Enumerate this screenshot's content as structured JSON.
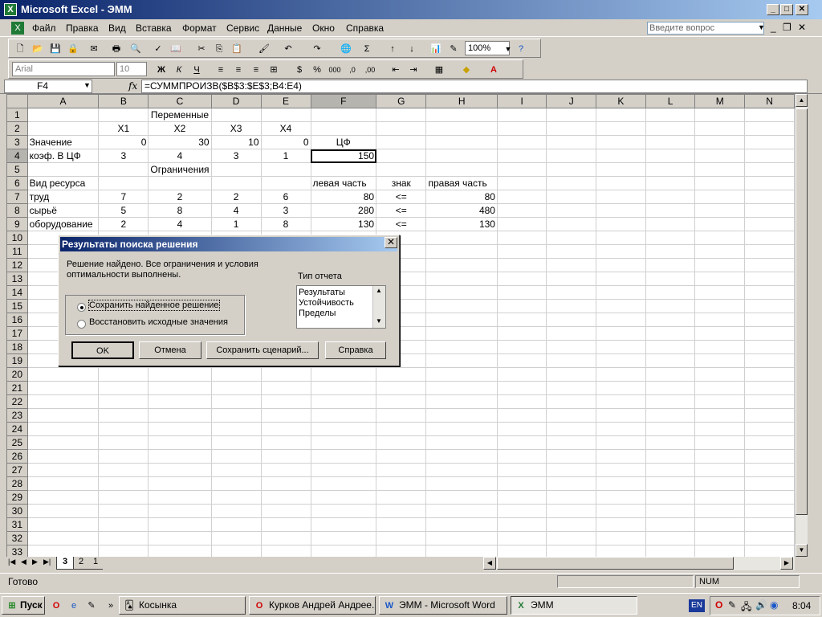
{
  "window": {
    "title": "Microsoft Excel - ЭММ",
    "controls": [
      "_",
      "□",
      "✕"
    ]
  },
  "menu": {
    "items": [
      "Файл",
      "Правка",
      "Вид",
      "Вставка",
      "Формат",
      "Сервис",
      "Данные",
      "Окно",
      "Справка"
    ],
    "help_placeholder": "Введите вопрос"
  },
  "toolbar": {
    "zoom": "100%",
    "font": "Arial",
    "size": "10"
  },
  "formula_bar": {
    "name_box": "F4",
    "fx": "fx",
    "formula": "=СУММПРОИЗВ($B$3:$E$3;B4:E4)"
  },
  "columns": [
    "A",
    "B",
    "C",
    "D",
    "E",
    "F",
    "G",
    "H",
    "I",
    "J",
    "K",
    "L",
    "M",
    "N"
  ],
  "cells": {
    "r1": {
      "C": "Переменные"
    },
    "r2": {
      "B": "X1",
      "C": "X2",
      "D": "X3",
      "E": "X4"
    },
    "r3": {
      "A": "Значение",
      "B": "0",
      "C": "30",
      "D": "10",
      "E": "0",
      "F": "ЦФ"
    },
    "r4": {
      "A": "коэф. В ЦФ",
      "B": "3",
      "C": "4",
      "D": "3",
      "E": "1",
      "F": "150"
    },
    "r5": {
      "C": "Ограничения"
    },
    "r6": {
      "A": "Вид ресурса",
      "F": "левая часть",
      "G": "знак",
      "H": "правая часть"
    },
    "r7": {
      "A": "труд",
      "B": "7",
      "C": "2",
      "D": "2",
      "E": "6",
      "F": "80",
      "G": "<=",
      "H": "80"
    },
    "r8": {
      "A": "сырьё",
      "B": "5",
      "C": "8",
      "D": "4",
      "E": "3",
      "F": "280",
      "G": "<=",
      "H": "480"
    },
    "r9": {
      "A": "оборудование",
      "B": "2",
      "C": "4",
      "D": "1",
      "E": "8",
      "F": "130",
      "G": "<=",
      "H": "130"
    }
  },
  "sheet_tabs": [
    "3",
    "2",
    "1"
  ],
  "status": {
    "left": "Готово",
    "num": "NUM"
  },
  "dialog": {
    "title": "Результаты поиска решения",
    "message": "Решение найдено. Все ограничения и условия оптимальности выполнены.",
    "report_label": "Тип отчета",
    "reports": [
      "Результаты",
      "Устойчивость",
      "Пределы"
    ],
    "radio_keep": "Сохранить найденное решение",
    "radio_restore": "Восстановить исходные значения",
    "btn_ok": "OK",
    "btn_cancel": "Отмена",
    "btn_save": "Сохранить сценарий...",
    "btn_help": "Справка"
  },
  "taskbar": {
    "start": "Пуск",
    "tasks": [
      "Косынка",
      "Курков Андрей Андрее...",
      "ЭММ - Microsoft Word",
      "ЭММ"
    ],
    "lang": "EN",
    "clock": "8:04"
  }
}
